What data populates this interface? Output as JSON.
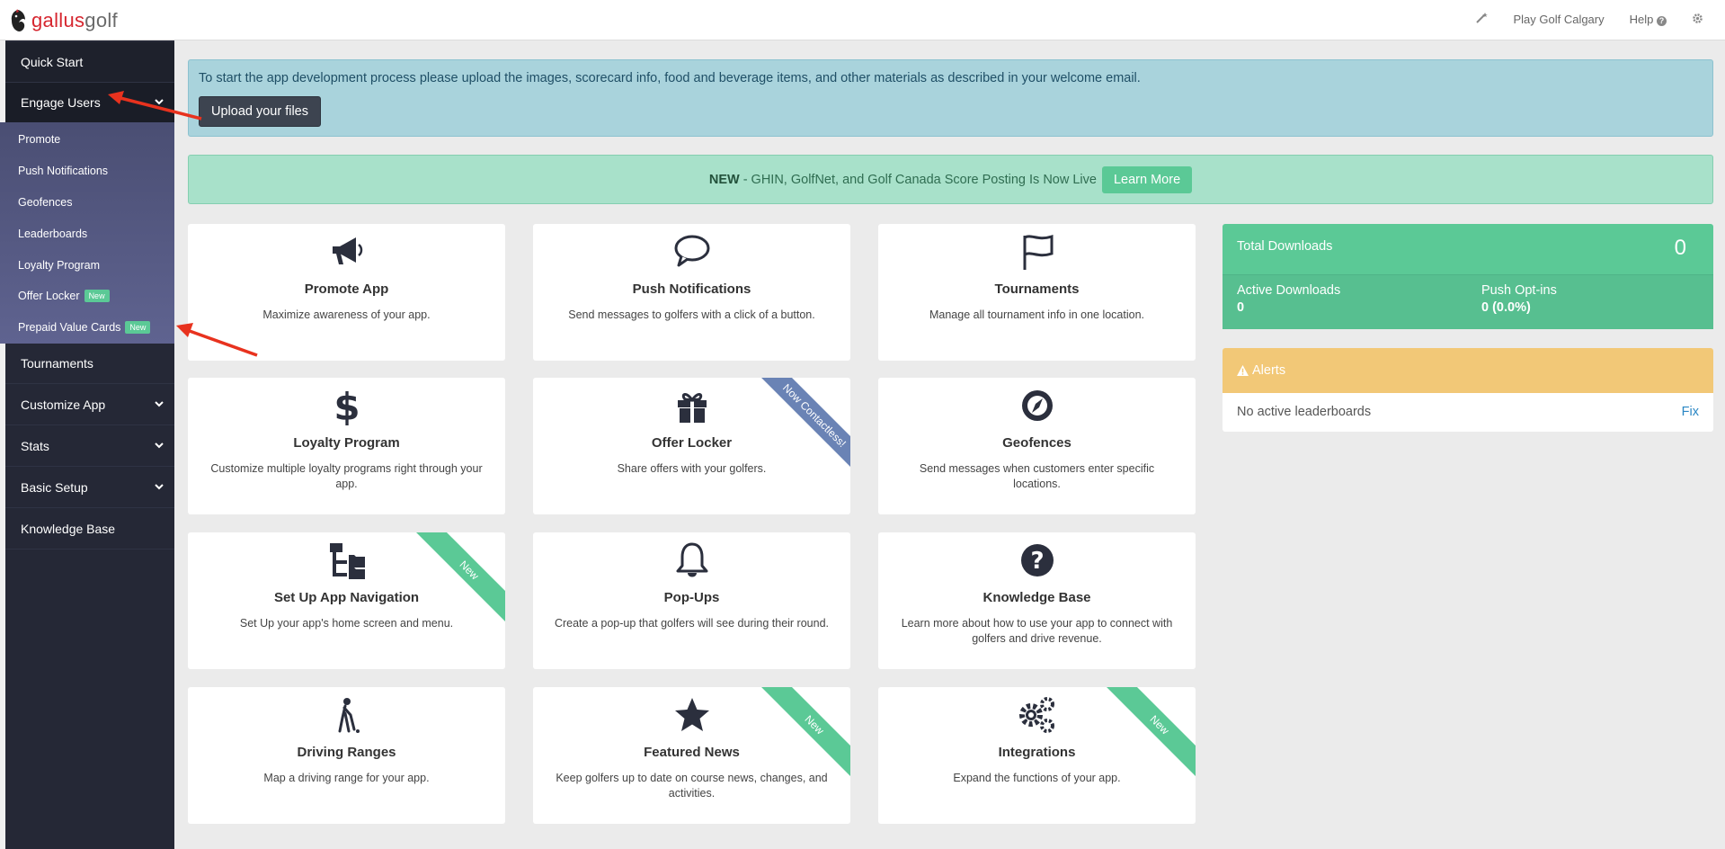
{
  "brand": {
    "name_part1": "gallus",
    "name_part2": "golf"
  },
  "topbar": {
    "account": "Play Golf Calgary",
    "help": "Help"
  },
  "sidebar": {
    "quick_start": "Quick Start",
    "engage_users": "Engage Users",
    "engage_sub": [
      {
        "label": "Promote"
      },
      {
        "label": "Push Notifications"
      },
      {
        "label": "Geofences"
      },
      {
        "label": "Leaderboards"
      },
      {
        "label": "Loyalty Program"
      },
      {
        "label": "Offer Locker",
        "badge": "New"
      },
      {
        "label": "Prepaid Value Cards",
        "badge": "New"
      }
    ],
    "tournaments": "Tournaments",
    "customize_app": "Customize App",
    "stats": "Stats",
    "basic_setup": "Basic Setup",
    "knowledge_base": "Knowledge Base"
  },
  "upload_banner": {
    "message": "To start the app development process please upload the images, scorecard info, food and beverage items, and other materials as described in your welcome email.",
    "button": "Upload your files"
  },
  "new_banner": {
    "prefix": "NEW",
    "message": "- GHIN, GolfNet, and Golf Canada Score Posting Is Now Live",
    "button": "Learn More"
  },
  "cards": [
    {
      "title": "Promote App",
      "desc": "Maximize awareness of your app.",
      "icon": "megaphone-icon"
    },
    {
      "title": "Push Notifications",
      "desc": "Send messages to golfers with a click of a button.",
      "icon": "speech-bubble-icon"
    },
    {
      "title": "Tournaments",
      "desc": "Manage all tournament info in one location.",
      "icon": "flag-icon"
    },
    {
      "title": "Loyalty Program",
      "desc": "Customize multiple loyalty programs right through your app.",
      "icon": "dollar-icon"
    },
    {
      "title": "Offer Locker",
      "desc": "Share offers with your golfers.",
      "icon": "gift-icon",
      "ribbon": "Now Contactless!"
    },
    {
      "title": "Geofences",
      "desc": "Send messages when customers enter specific locations.",
      "icon": "compass-icon"
    },
    {
      "title": "Set Up App Navigation",
      "desc": "Set Up your app's home screen and menu.",
      "icon": "sitemap-icon",
      "ribbon": "New"
    },
    {
      "title": "Pop-Ups",
      "desc": "Create a pop-up that golfers will see during their round.",
      "icon": "bell-icon"
    },
    {
      "title": "Knowledge Base",
      "desc": "Learn more about how to use your app to connect with golfers and drive revenue.",
      "icon": "question-circle-icon"
    },
    {
      "title": "Driving Ranges",
      "desc": "Map a driving range for your app.",
      "icon": "golfer-icon"
    },
    {
      "title": "Featured News",
      "desc": "Keep golfers up to date on course news, changes, and activities.",
      "icon": "star-icon",
      "ribbon": "New"
    },
    {
      "title": "Integrations",
      "desc": "Expand the functions of your app.",
      "icon": "gears-icon",
      "ribbon": "New"
    }
  ],
  "stats": {
    "total_downloads_label": "Total Downloads",
    "total_downloads_value": "0",
    "active_downloads_label": "Active Downloads",
    "active_downloads_value": "0",
    "push_optins_label": "Push Opt-ins",
    "push_optins_value": "0 (0.0%)"
  },
  "alerts": {
    "title": "Alerts",
    "message": "No active leaderboards",
    "action": "Fix"
  },
  "colors": {
    "sidebar_bg": "#252836",
    "submenu_bg": "#5a5e8a",
    "accent_green": "#5bc996",
    "upload_banner_bg": "#a9d3dc",
    "new_banner_bg": "#a8e1ca",
    "alert_header": "#f2c877",
    "ribbon_blue": "#6a83b5"
  }
}
